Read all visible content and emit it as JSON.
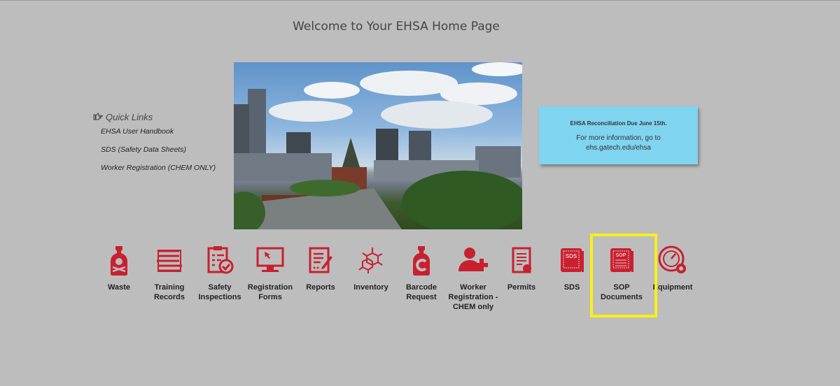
{
  "page": {
    "title": "Welcome to Your EHSA Home Page"
  },
  "quick_links": {
    "heading": "Quick Links",
    "icon": "pointing-hand-icon",
    "items": [
      {
        "label": "EHSA User Handbook"
      },
      {
        "label": "SDS (Safety Data Sheets)"
      },
      {
        "label": "Worker Registration (CHEM ONLY)"
      }
    ]
  },
  "hero_image": {
    "alt": "Campus tower with city skyline"
  },
  "notice": {
    "heading": "EHSA Reconciliation Due June 15th.",
    "line1": "For more information, go to",
    "line2": "ehs.gatech.edu/ehsa",
    "bg": "#7fd4ef"
  },
  "colors": {
    "icon": "#c8202f",
    "highlight": "#f7f018"
  },
  "tiles": [
    {
      "l1": "Waste",
      "l2": "",
      "l3": "",
      "icon": "poison-bottle-icon"
    },
    {
      "l1": "Training",
      "l2": "Records",
      "l3": "",
      "icon": "books-icon"
    },
    {
      "l1": "Safety",
      "l2": "Inspections",
      "l3": "",
      "icon": "clipboard-check-icon"
    },
    {
      "l1": "Registration",
      "l2": "Forms",
      "l3": "",
      "icon": "monitor-cursor-icon"
    },
    {
      "l1": "Reports",
      "l2": "",
      "l3": "",
      "icon": "report-pen-icon"
    },
    {
      "l1": "Inventory",
      "l2": "",
      "l3": "",
      "icon": "molecule-icon"
    },
    {
      "l1": "Barcode",
      "l2": "Request",
      "l3": "",
      "icon": "bottle-c-icon"
    },
    {
      "l1": "Worker",
      "l2": "Registration -",
      "l3": "CHEM only",
      "icon": "add-user-icon"
    },
    {
      "l1": "Permits",
      "l2": "",
      "l3": "",
      "icon": "permit-doc-icon"
    },
    {
      "l1": "SDS",
      "l2": "",
      "l3": "",
      "icon": "sds-book-icon"
    },
    {
      "l1": "SOP",
      "l2": "Documents",
      "l3": "",
      "icon": "sop-book-icon"
    },
    {
      "l1": "Equipment",
      "l2": "",
      "l3": "",
      "icon": "gauge-gear-icon"
    }
  ]
}
